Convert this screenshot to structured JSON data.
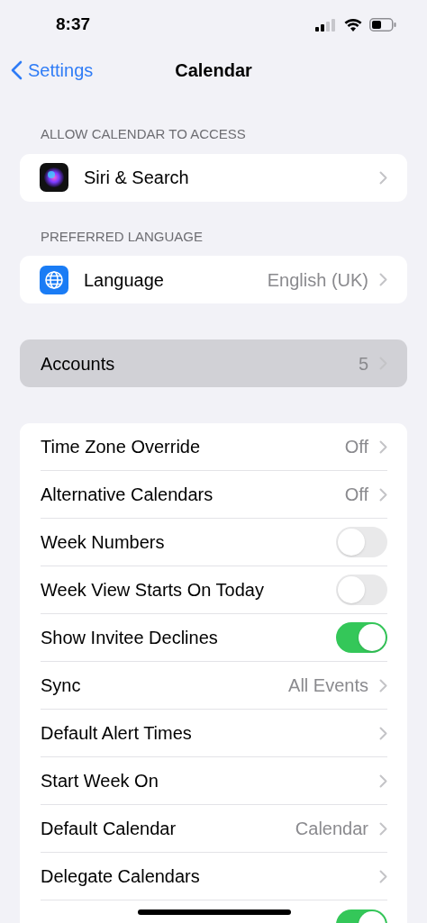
{
  "status_bar": {
    "time": "8:37"
  },
  "nav": {
    "back": "Settings",
    "title": "Calendar"
  },
  "sections": [
    {
      "header": "ALLOW CALENDAR TO ACCESS",
      "rows": [
        {
          "kind": "chevron",
          "label": "Siri & Search"
        }
      ]
    },
    {
      "header": "PREFERRED LANGUAGE",
      "rows": [
        {
          "kind": "value",
          "label": "Language",
          "value": "English (UK)"
        }
      ]
    },
    {
      "rows": [
        {
          "kind": "value",
          "label": "Accounts",
          "value": "5",
          "selected": true
        }
      ]
    },
    {
      "rows": [
        {
          "kind": "value",
          "label": "Time Zone Override",
          "value": "Off"
        },
        {
          "kind": "value",
          "label": "Alternative Calendars",
          "value": "Off"
        },
        {
          "kind": "toggle",
          "label": "Week Numbers",
          "on": false
        },
        {
          "kind": "toggle",
          "label": "Week View Starts On Today",
          "on": false
        },
        {
          "kind": "toggle",
          "label": "Show Invitee Declines",
          "on": true
        },
        {
          "kind": "value",
          "label": "Sync",
          "value": "All Events"
        },
        {
          "kind": "chevron",
          "label": "Default Alert Times"
        },
        {
          "kind": "chevron",
          "label": "Start Week On"
        },
        {
          "kind": "value",
          "label": "Default Calendar",
          "value": "Calendar"
        },
        {
          "kind": "chevron",
          "label": "Delegate Calendars"
        },
        {
          "kind": "toggle",
          "on": true
        }
      ]
    }
  ]
}
